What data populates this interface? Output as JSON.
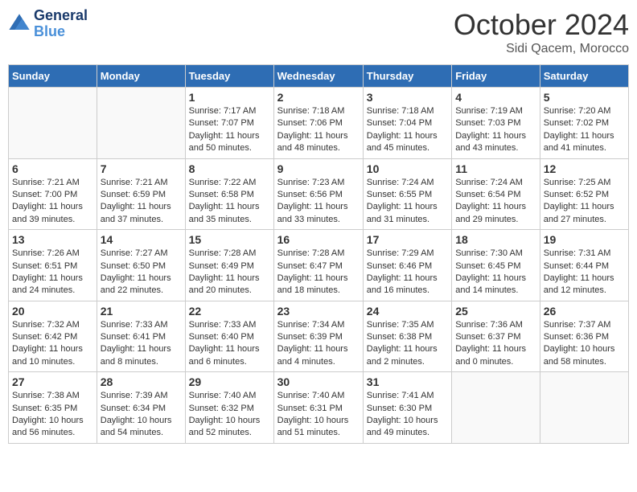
{
  "header": {
    "logo_line1": "General",
    "logo_line2": "Blue",
    "month": "October 2024",
    "location": "Sidi Qacem, Morocco"
  },
  "weekdays": [
    "Sunday",
    "Monday",
    "Tuesday",
    "Wednesday",
    "Thursday",
    "Friday",
    "Saturday"
  ],
  "weeks": [
    [
      {
        "day": "",
        "empty": true
      },
      {
        "day": "",
        "empty": true
      },
      {
        "day": "1",
        "sunrise": "7:17 AM",
        "sunset": "7:07 PM",
        "daylight": "11 hours and 50 minutes."
      },
      {
        "day": "2",
        "sunrise": "7:18 AM",
        "sunset": "7:06 PM",
        "daylight": "11 hours and 48 minutes."
      },
      {
        "day": "3",
        "sunrise": "7:18 AM",
        "sunset": "7:04 PM",
        "daylight": "11 hours and 45 minutes."
      },
      {
        "day": "4",
        "sunrise": "7:19 AM",
        "sunset": "7:03 PM",
        "daylight": "11 hours and 43 minutes."
      },
      {
        "day": "5",
        "sunrise": "7:20 AM",
        "sunset": "7:02 PM",
        "daylight": "11 hours and 41 minutes."
      }
    ],
    [
      {
        "day": "6",
        "sunrise": "7:21 AM",
        "sunset": "7:00 PM",
        "daylight": "11 hours and 39 minutes."
      },
      {
        "day": "7",
        "sunrise": "7:21 AM",
        "sunset": "6:59 PM",
        "daylight": "11 hours and 37 minutes."
      },
      {
        "day": "8",
        "sunrise": "7:22 AM",
        "sunset": "6:58 PM",
        "daylight": "11 hours and 35 minutes."
      },
      {
        "day": "9",
        "sunrise": "7:23 AM",
        "sunset": "6:56 PM",
        "daylight": "11 hours and 33 minutes."
      },
      {
        "day": "10",
        "sunrise": "7:24 AM",
        "sunset": "6:55 PM",
        "daylight": "11 hours and 31 minutes."
      },
      {
        "day": "11",
        "sunrise": "7:24 AM",
        "sunset": "6:54 PM",
        "daylight": "11 hours and 29 minutes."
      },
      {
        "day": "12",
        "sunrise": "7:25 AM",
        "sunset": "6:52 PM",
        "daylight": "11 hours and 27 minutes."
      }
    ],
    [
      {
        "day": "13",
        "sunrise": "7:26 AM",
        "sunset": "6:51 PM",
        "daylight": "11 hours and 24 minutes."
      },
      {
        "day": "14",
        "sunrise": "7:27 AM",
        "sunset": "6:50 PM",
        "daylight": "11 hours and 22 minutes."
      },
      {
        "day": "15",
        "sunrise": "7:28 AM",
        "sunset": "6:49 PM",
        "daylight": "11 hours and 20 minutes."
      },
      {
        "day": "16",
        "sunrise": "7:28 AM",
        "sunset": "6:47 PM",
        "daylight": "11 hours and 18 minutes."
      },
      {
        "day": "17",
        "sunrise": "7:29 AM",
        "sunset": "6:46 PM",
        "daylight": "11 hours and 16 minutes."
      },
      {
        "day": "18",
        "sunrise": "7:30 AM",
        "sunset": "6:45 PM",
        "daylight": "11 hours and 14 minutes."
      },
      {
        "day": "19",
        "sunrise": "7:31 AM",
        "sunset": "6:44 PM",
        "daylight": "11 hours and 12 minutes."
      }
    ],
    [
      {
        "day": "20",
        "sunrise": "7:32 AM",
        "sunset": "6:42 PM",
        "daylight": "11 hours and 10 minutes."
      },
      {
        "day": "21",
        "sunrise": "7:33 AM",
        "sunset": "6:41 PM",
        "daylight": "11 hours and 8 minutes."
      },
      {
        "day": "22",
        "sunrise": "7:33 AM",
        "sunset": "6:40 PM",
        "daylight": "11 hours and 6 minutes."
      },
      {
        "day": "23",
        "sunrise": "7:34 AM",
        "sunset": "6:39 PM",
        "daylight": "11 hours and 4 minutes."
      },
      {
        "day": "24",
        "sunrise": "7:35 AM",
        "sunset": "6:38 PM",
        "daylight": "11 hours and 2 minutes."
      },
      {
        "day": "25",
        "sunrise": "7:36 AM",
        "sunset": "6:37 PM",
        "daylight": "11 hours and 0 minutes."
      },
      {
        "day": "26",
        "sunrise": "7:37 AM",
        "sunset": "6:36 PM",
        "daylight": "10 hours and 58 minutes."
      }
    ],
    [
      {
        "day": "27",
        "sunrise": "7:38 AM",
        "sunset": "6:35 PM",
        "daylight": "10 hours and 56 minutes."
      },
      {
        "day": "28",
        "sunrise": "7:39 AM",
        "sunset": "6:34 PM",
        "daylight": "10 hours and 54 minutes."
      },
      {
        "day": "29",
        "sunrise": "7:40 AM",
        "sunset": "6:32 PM",
        "daylight": "10 hours and 52 minutes."
      },
      {
        "day": "30",
        "sunrise": "7:40 AM",
        "sunset": "6:31 PM",
        "daylight": "10 hours and 51 minutes."
      },
      {
        "day": "31",
        "sunrise": "7:41 AM",
        "sunset": "6:30 PM",
        "daylight": "10 hours and 49 minutes."
      },
      {
        "day": "",
        "empty": true
      },
      {
        "day": "",
        "empty": true
      }
    ]
  ]
}
